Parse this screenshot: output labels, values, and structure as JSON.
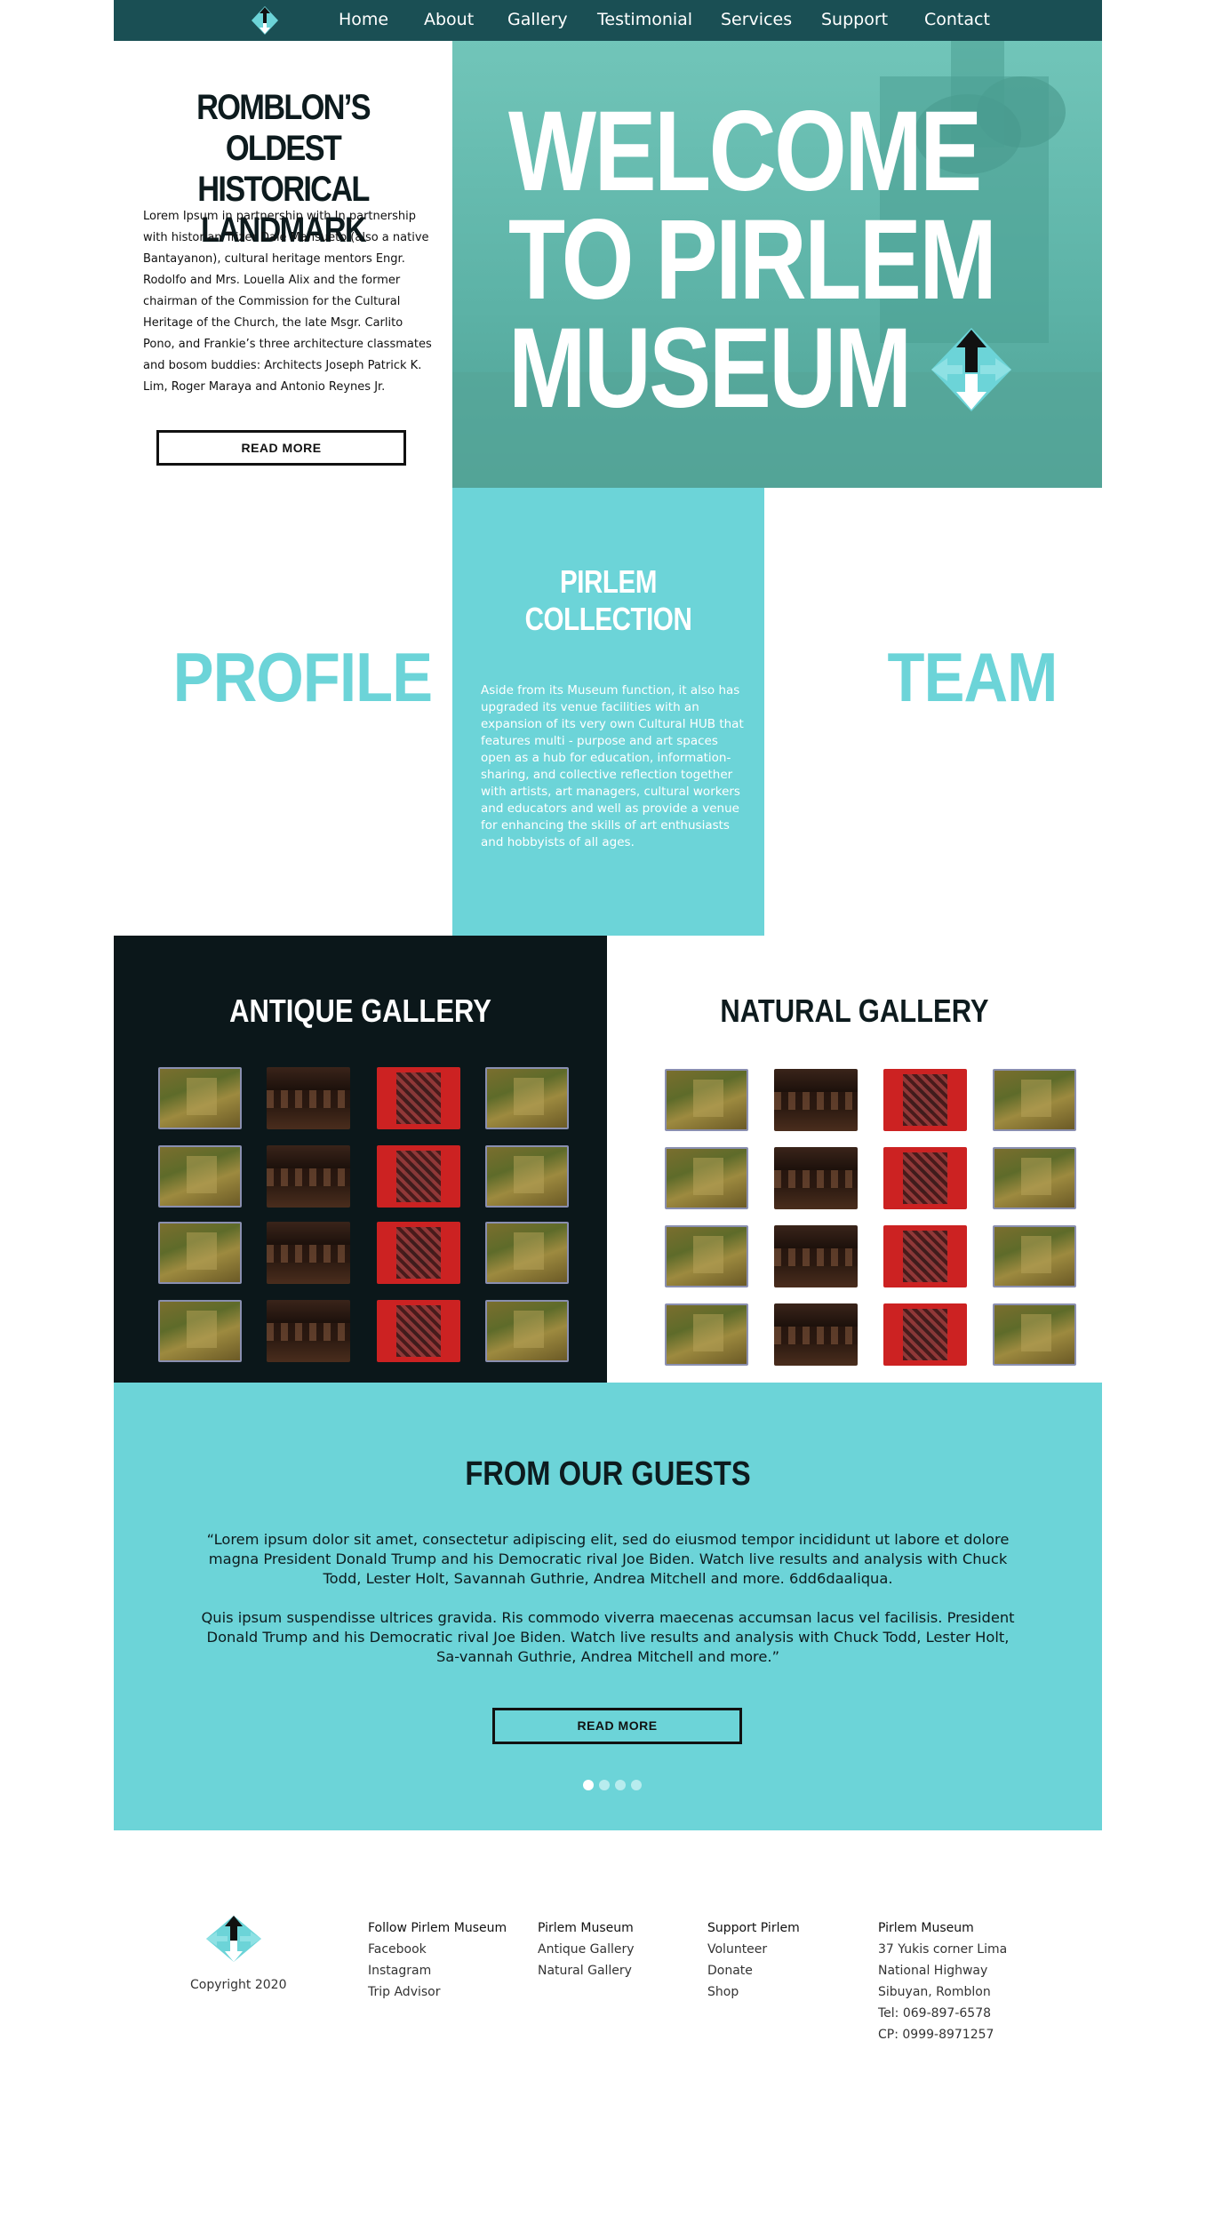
{
  "colors": {
    "nav_bg": "#1a4f54",
    "accent": "#6cd4d8",
    "dark": "#0b171a",
    "hero_overlay": "#5fb9ad",
    "white": "#ffffff"
  },
  "nav": {
    "logo_icon": "museum-arrows-logo-icon",
    "items": [
      {
        "label": "Home"
      },
      {
        "label": "About"
      },
      {
        "label": "Gallery"
      },
      {
        "label": "Testimonial"
      },
      {
        "label": "Services"
      },
      {
        "label": "Support"
      },
      {
        "label": "Contact"
      }
    ]
  },
  "hero": {
    "left_title_line1": "ROMBLON’S OLDEST",
    "left_title_line2": "HISTORICAL LANDMARK",
    "left_text": "Lorem Ipsum in partnership with In partnership with historian Trizer Dale Mansueto (also a native Bantayanon), cultural heritage mentors Engr. Rodolfo and Mrs. Louella Alix and the former chairman of the Commission for the Cultural Heritage of the Church, the late Msgr. Carlito Pono, and Frankie’s three architecture classmates and bosom buddies: Architects Joseph Patrick K. Lim, Roger Maraya and Antonio Reynes Jr.",
    "read_more": "READ MORE",
    "title_line1": "WELCOME",
    "title_line2": "TO PIRLEM",
    "title_line3": "MUSEUM",
    "logo_icon": "museum-arrows-logo-icon"
  },
  "about": {
    "profile": "PROFILE",
    "team": "TEAM",
    "collection_title": "PIRLEM COLLECTION",
    "collection_text": "Aside from its Museum function, it also has upgraded its venue facilities with an expansion of its very own Cultural HUB that features multi - purpose and art spaces open as a hub for education, information-sharing, and collective reflection together with artists, art managers, cultural workers and educators and well as provide a venue for enhancing the skills of art enthusiasts and hobbyists of all ages."
  },
  "galleries": {
    "antique_title": "ANTIQUE GALLERY",
    "natural_title": "NATURAL GALLERY",
    "rows": 4,
    "columns": [
      "painting",
      "interior",
      "red-tapestry",
      "painting"
    ]
  },
  "guests": {
    "title": "FROM OUR GUESTS",
    "quote_p1": "“Lorem ipsum dolor sit amet, consectetur adipiscing elit, sed do eiusmod tempor incididunt ut labore et dolore magna President Donald Trump and his Democratic rival Joe Biden. Watch live results and analysis with Chuck Todd, Lester Holt, Savannah Guthrie, Andrea Mitchell and more. 6dd6daaliqua.",
    "quote_p2": "Quis ipsum suspendisse ultrices gravida. Ris commodo viverra maecenas accumsan lacus vel facilisis.  President Donald Trump and his Democratic rival Joe Biden. Watch live results and analysis with Chuck Todd, Lester Holt, Sa-vannah Guthrie, Andrea Mitchell and more.”",
    "read_more": "READ MORE",
    "slides": 4,
    "active_slide": 1
  },
  "footer": {
    "copyright": "Copyright 2020",
    "col1_head": "Follow Pirlem Museum",
    "col1_links": [
      "Facebook",
      "Instagram",
      "Trip Advisor"
    ],
    "col2_head": "Pirlem Museum",
    "col2_links": [
      "Antique Gallery",
      "Natural Gallery"
    ],
    "col3_head": "Support Pirlem",
    "col3_links": [
      "Volunteer",
      "Donate",
      "Shop"
    ],
    "col4_head": "Pirlem Museum",
    "col4_lines": [
      "37 Yukis corner Lima",
      "National Highway",
      "Sibuyan, Romblon",
      "Tel: 069-897-6578",
      "CP: 0999-8971257"
    ]
  }
}
